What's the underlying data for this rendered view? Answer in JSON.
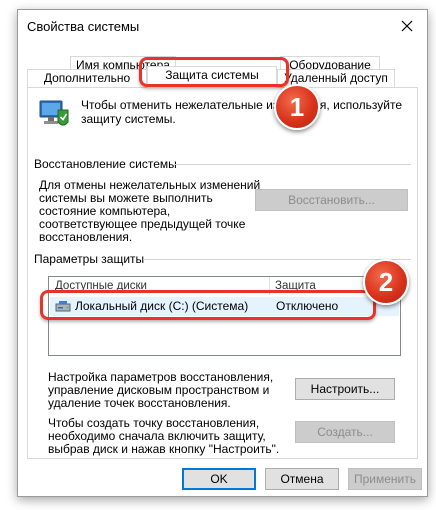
{
  "window": {
    "title": "Свойства системы",
    "close_icon": "close-icon"
  },
  "tabs": {
    "row1": [
      "Имя компьютера",
      "Оборудование"
    ],
    "row2": [
      "Дополнительно",
      "Защита системы",
      "Удаленный доступ"
    ],
    "active": "Защита системы"
  },
  "intro": {
    "icon": "system-protection-icon",
    "line1": "Чтобы отменить нежелательные изменения, используйте",
    "line2": "защиту системы."
  },
  "restore": {
    "section": "Восстановление системы",
    "desc": [
      "Для отмены нежелательных изменений",
      "системы вы можете выполнить",
      "состояние компьютера,",
      "соответствующее предыдущей точке",
      "восстановления."
    ],
    "button": "Восстановить..."
  },
  "protection": {
    "section": "Параметры защиты",
    "col_disks": "Доступные диски",
    "col_protection": "Защита",
    "rows": [
      {
        "icon": "drive-icon",
        "name": "Локальный диск (C:) (Система)",
        "status": "Отключено"
      }
    ]
  },
  "configure": {
    "text": [
      "Настройка параметров восстановления,",
      "управление дисковым пространством и",
      "удаление точек восстановления."
    ],
    "button": "Настроить..."
  },
  "create": {
    "text": [
      "Чтобы создать точку восстановления,",
      "необходимо сначала включить защиту,",
      "выбрав диск и нажав кнопку \"Настроить\"."
    ],
    "button": "Создать..."
  },
  "footer": {
    "ok": "OK",
    "cancel": "Отмена",
    "apply": "Применить"
  },
  "badges": [
    "1",
    "2"
  ],
  "colors": {
    "callout": "#e8322a",
    "selection": "#e5f3ff",
    "focus": "#0078d7"
  }
}
